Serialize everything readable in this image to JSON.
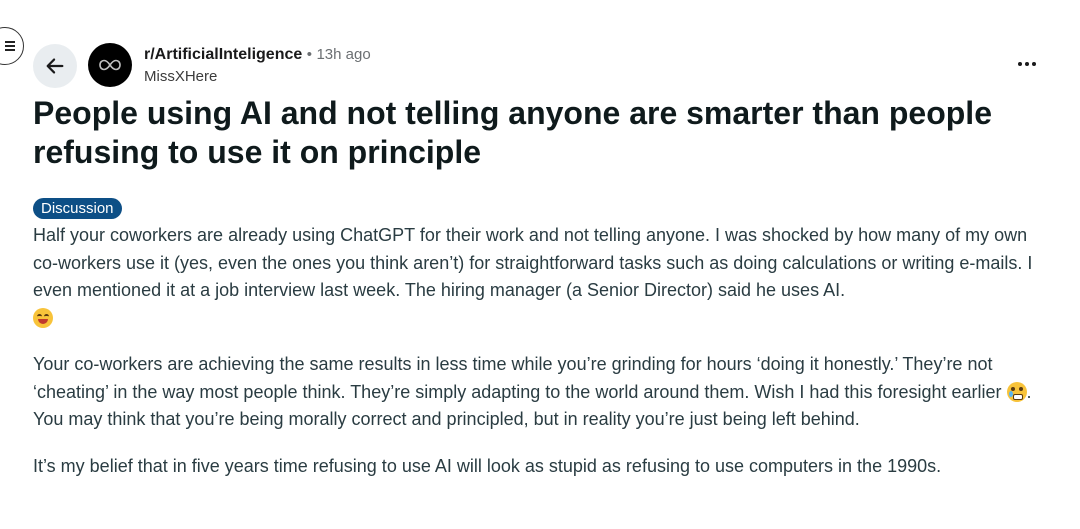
{
  "post": {
    "subreddit": "r/ArtificialInteligence",
    "separator": "•",
    "time_ago": "13h ago",
    "author": "MissXHere",
    "title": "People using AI and not telling anyone are smarter than people refusing to use it on principle",
    "flair": "Discussion",
    "flair_color": "#0d4f86",
    "body": {
      "p1": "Half your coworkers are already using ChatGPT for their work and not telling anyone. I was shocked by how many of my own co-workers use it (yes, even the ones you think aren’t) for straightforward tasks such as doing calculations or writing e-mails. I even mentioned it at a job interview last week. The hiring manager (a Senior Director) said he uses AI.",
      "p1_emoji": "rolling-on-floor-laughing-icon",
      "p2_part1": "Your co-workers are achieving the same results in less time while you’re grinding for hours ‘doing it honestly.’ They’re not ‘cheating’ in the way most people think. They’re simply adapting to the world around them. Wish I had this foresight earlier ",
      "p2_emoji": "face-with-tears-icon",
      "p2_part2": ". You may think that you’re being morally correct and principled, but in reality you’re just being left behind.",
      "p3": "It’s my belief that in five years time refusing to use AI will look as stupid as refusing to use computers in the 1990s."
    }
  },
  "icons": {
    "menu": "hamburger-menu-icon",
    "back": "arrow-left-icon",
    "avatar": "infinity-icon",
    "more": "more-options-icon"
  }
}
